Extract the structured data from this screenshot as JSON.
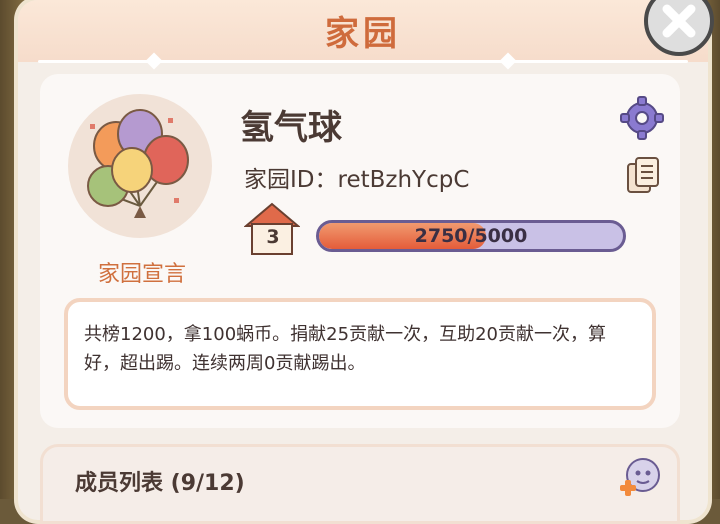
{
  "dialog": {
    "title": "家园"
  },
  "home": {
    "name": "氢气球",
    "id_line": "家园ID：retBzhYcpC",
    "level": "3",
    "progress_text": "2750/5000",
    "progress_value": 2750,
    "progress_max": 5000,
    "declaration_label": "家园宣言",
    "declaration_text": "共榜1200，拿100蜗币。捐献25贡献一次，互助20贡献一次，算好，超出踢。连续两周0贡献踢出。"
  },
  "members": {
    "title": "成员列表 (9/12)"
  },
  "icons": {
    "close": "close-icon",
    "settings": "gear-icon",
    "copy": "copy-icon",
    "level": "house-level-icon",
    "invite": "add-member-icon",
    "avatar": "balloons-avatar"
  },
  "colors": {
    "title": "#cf6b3c",
    "progress_fill": "#e45c3a",
    "progress_track": "#c9c1e6"
  }
}
